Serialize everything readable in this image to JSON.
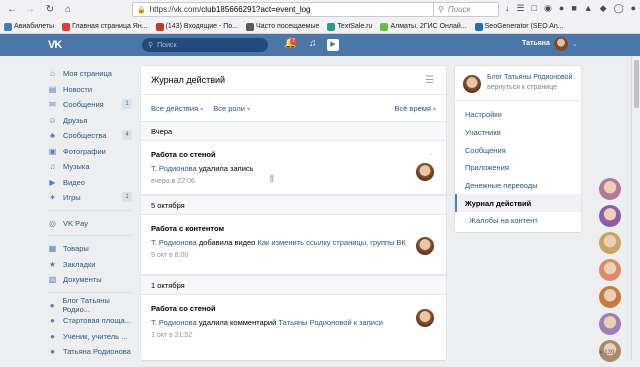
{
  "browser": {
    "url_prefix": "https://vk.com/",
    "url_path": "club185666291?act=event_log",
    "search_placeholder": "Поиск",
    "bookmarks": [
      {
        "label": "Авиабилеты",
        "color": "#3b82c4"
      },
      {
        "label": "Главная страница Ян...",
        "color": "#e23b2e"
      },
      {
        "label": "(143) Входящие - По...",
        "color": "#c0392b"
      },
      {
        "label": "Часто посещаемые",
        "color": "#5a5a5a"
      },
      {
        "label": "TextSale.ru",
        "color": "#2a9d8f"
      },
      {
        "label": "Алматы. 2ГИС Онлай...",
        "color": "#6bbf3a"
      },
      {
        "label": "SeoGenerator (SEO An...",
        "color": "#1e6ec8"
      }
    ]
  },
  "vk_header": {
    "logo": "VK",
    "search_placeholder": "Поиск",
    "notif_count": "2",
    "user_name": "Татьяна"
  },
  "left_nav": {
    "items": [
      {
        "label": "Моя страница",
        "icon": "home-icon",
        "count": ""
      },
      {
        "label": "Новости",
        "icon": "news-icon",
        "count": ""
      },
      {
        "label": "Сообщения",
        "icon": "messages-icon",
        "count": "1"
      },
      {
        "label": "Друзья",
        "icon": "friends-icon",
        "count": ""
      },
      {
        "label": "Сообщества",
        "icon": "communities-icon",
        "count": "4"
      },
      {
        "label": "Фотографии",
        "icon": "photos-icon",
        "count": ""
      },
      {
        "label": "Музыка",
        "icon": "music-icon",
        "count": ""
      },
      {
        "label": "Видео",
        "icon": "video-icon",
        "count": ""
      },
      {
        "label": "Игры",
        "icon": "games-icon",
        "count": "1"
      }
    ],
    "items2": [
      {
        "label": "VK Pay",
        "icon": "vkpay-icon"
      }
    ],
    "items3": [
      {
        "label": "Товары",
        "icon": "goods-icon"
      },
      {
        "label": "Закладки",
        "icon": "bookmarks-icon"
      },
      {
        "label": "Документы",
        "icon": "documents-icon"
      }
    ],
    "items4": [
      {
        "label": "Блог Татьяны Родио...",
        "icon": "group-icon"
      },
      {
        "label": "Стартовая площа...",
        "icon": "group-icon"
      },
      {
        "label": "Ученик, учитель ...",
        "icon": "group-icon"
      },
      {
        "label": "Татьяна Родионова",
        "icon": "group-icon"
      }
    ]
  },
  "main": {
    "title": "Журнал действий",
    "filter_actions": "Все действия",
    "filter_roles": "Все роли",
    "filter_time": "Всё время",
    "day1": "Вчера",
    "event1": {
      "title": "Работа со стеной",
      "actor": "Т. Родионова",
      "action": "удалила запись",
      "date": "вчера в 22:06"
    },
    "day2": "5 октября",
    "event2": {
      "title": "Работа с контентом",
      "actor": "Т. Родионова",
      "action": "добавила видео",
      "object": "Как изменить ссылку страницы, группы ВК",
      "date": "5 окт в 8:00"
    },
    "day3": "1 октября",
    "event3": {
      "title": "Работа со стеной",
      "actor": "Т. Родионова",
      "action": "удалила комментарий",
      "object": "Татьяны Родионовой",
      "suffix": "к записи",
      "date": "1 окт в 21:52"
    }
  },
  "right_menu": {
    "group_name": "Блог Татьяны Родионовой",
    "back_label": "вернуться к странице",
    "items": [
      {
        "label": "Настройки"
      },
      {
        "label": "Участники"
      },
      {
        "label": "Сообщения"
      },
      {
        "label": "Приложения"
      },
      {
        "label": "Денежные переводы"
      }
    ],
    "active_item": "Журнал действий",
    "sub_item": "Жалобы на контент"
  },
  "friends_online": {
    "count": "139",
    "colors": [
      "#b07a9a",
      "#8e5cab",
      "#c9a46a",
      "#d98b6a",
      "#c77a3a",
      "#9b7fb5",
      "#a58a6e"
    ]
  }
}
